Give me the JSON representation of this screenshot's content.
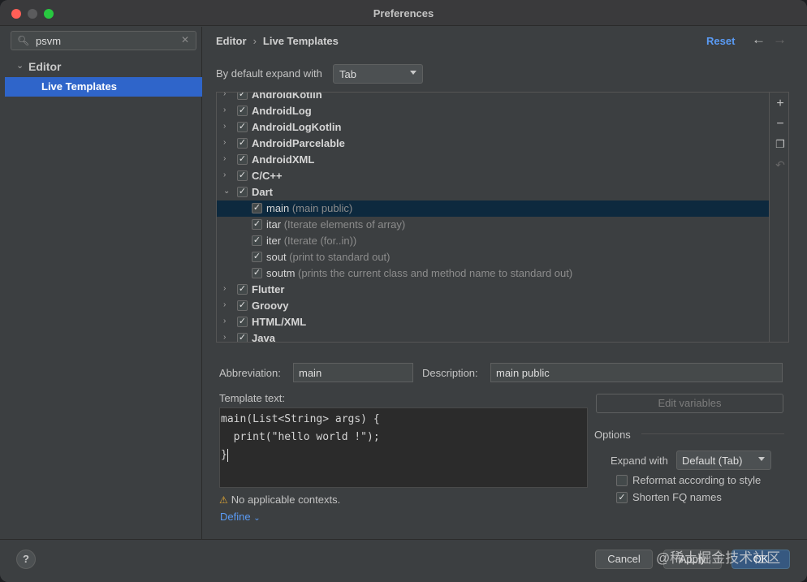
{
  "window": {
    "title": "Preferences"
  },
  "sidebar": {
    "search_value": "psvm",
    "items": [
      {
        "label": "Editor"
      },
      {
        "label": "Live Templates"
      }
    ]
  },
  "header": {
    "breadcrumb": [
      "Editor",
      "Live Templates"
    ],
    "reset_label": "Reset"
  },
  "expand": {
    "label": "By default expand with",
    "value": "Tab"
  },
  "templates": [
    {
      "label": "AndroidKotlin",
      "group": true,
      "checked": true,
      "expanded": false
    },
    {
      "label": "AndroidLog",
      "group": true,
      "checked": true,
      "expanded": false
    },
    {
      "label": "AndroidLogKotlin",
      "group": true,
      "checked": true,
      "expanded": false
    },
    {
      "label": "AndroidParcelable",
      "group": true,
      "checked": true,
      "expanded": false
    },
    {
      "label": "AndroidXML",
      "group": true,
      "checked": true,
      "expanded": false
    },
    {
      "label": "C/C++",
      "group": true,
      "checked": true,
      "expanded": false
    },
    {
      "label": "Dart",
      "group": true,
      "checked": true,
      "expanded": true
    },
    {
      "label": "main",
      "desc": "(main public)",
      "group": false,
      "checked": true,
      "selected": true
    },
    {
      "label": "itar",
      "desc": "(Iterate elements of array)",
      "group": false,
      "checked": true
    },
    {
      "label": "iter",
      "desc": "(Iterate (for..in))",
      "group": false,
      "checked": true
    },
    {
      "label": "sout",
      "desc": "(print to standard out)",
      "group": false,
      "checked": true
    },
    {
      "label": "soutm",
      "desc": "(prints the current class and method name to standard out)",
      "group": false,
      "checked": true
    },
    {
      "label": "Flutter",
      "group": true,
      "checked": true,
      "expanded": false
    },
    {
      "label": "Groovy",
      "group": true,
      "checked": true,
      "expanded": false
    },
    {
      "label": "HTML/XML",
      "group": true,
      "checked": true,
      "expanded": false
    },
    {
      "label": "Java",
      "group": true,
      "checked": true,
      "expanded": false
    }
  ],
  "toolbar_icons": [
    "add-icon",
    "remove-icon",
    "copy-icon",
    "restore-icon"
  ],
  "detail": {
    "abbreviation_label": "Abbreviation:",
    "abbreviation_value": "main",
    "description_label": "Description:",
    "description_value": "main public",
    "template_text_label": "Template text:",
    "template_lines": [
      "main(List<String> args) {",
      "  print(\"hello world !\");",
      "}"
    ],
    "edit_variables_label": "Edit variables",
    "options_label": "Options",
    "expand_with_label": "Expand with",
    "expand_with_value": "Default (Tab)",
    "reformat_label": "Reformat according to style",
    "reformat_checked": false,
    "shorten_label": "Shorten FQ names",
    "shorten_checked": true,
    "warning_text": "No applicable contexts.",
    "define_label": "Define"
  },
  "footer": {
    "help_label": "?",
    "cancel_label": "Cancel",
    "apply_label": "Apply",
    "ok_label": "OK",
    "watermark": "@稀土掘金技术社区"
  },
  "colors": {
    "accent": "#2f65ca",
    "link": "#5a9bf5",
    "selection": "#0d293e",
    "warning": "#e5a832"
  }
}
